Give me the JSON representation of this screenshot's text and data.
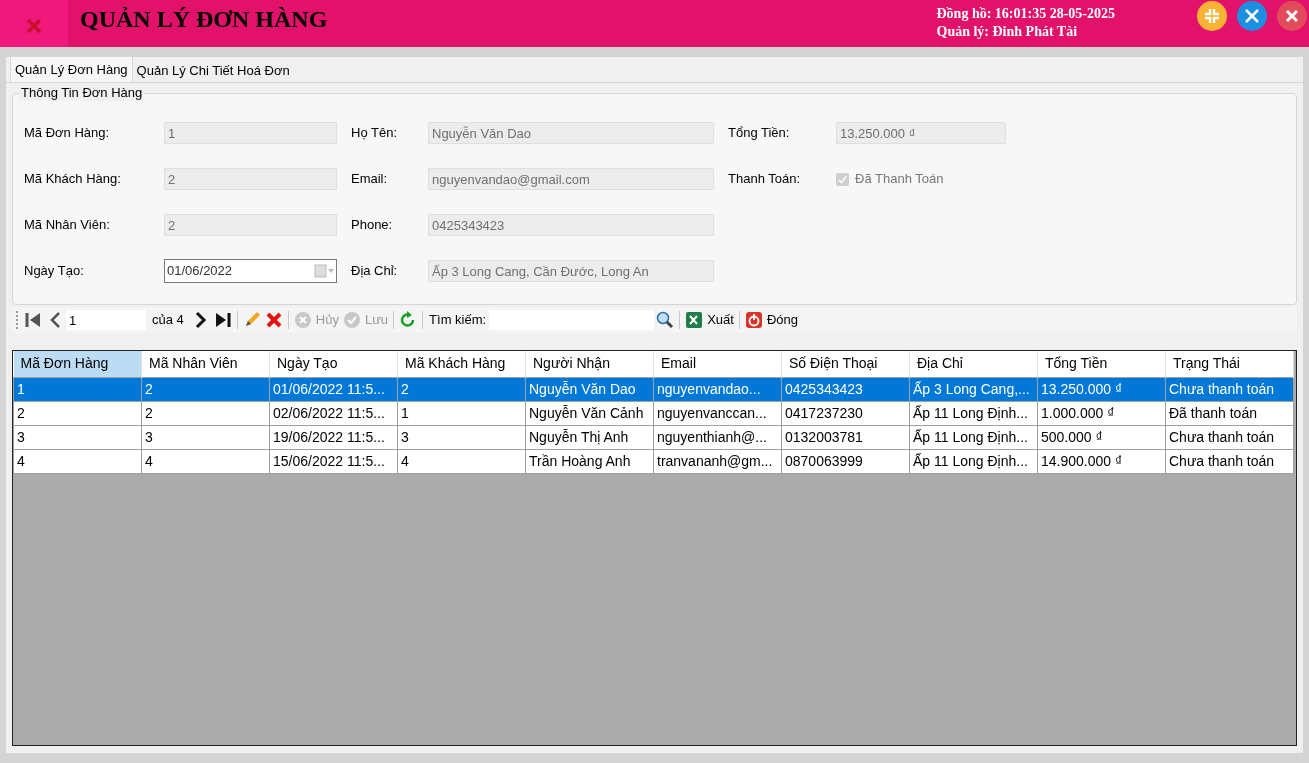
{
  "header": {
    "title": "QUẢN LÝ ĐƠN HÀNG",
    "clock": "Đồng hồ: 16:01:35 28-05-2025",
    "manager": "Quản lý: Đinh Phát Tài"
  },
  "tabs": [
    {
      "label": "Quản Lý Đơn Hàng",
      "selected": true
    },
    {
      "label": "Quản Lý Chi Tiết Hoá Đơn",
      "selected": false
    }
  ],
  "group": {
    "title": "Thông Tin Đơn Hàng",
    "field_columns": [
      [
        {
          "kind": "text",
          "label": "Mã Đơn Hàng:",
          "value": "1"
        },
        {
          "kind": "text",
          "label": "Mã Khách Hàng:",
          "value": "2"
        },
        {
          "kind": "text",
          "label": "Mã Nhân Viên:",
          "value": "2"
        },
        {
          "kind": "date",
          "label": "Ngày Tạo:",
          "value": "01/06/2022"
        }
      ],
      [
        {
          "kind": "text",
          "label": "Họ Tên:",
          "value": "Nguyễn Văn Dao"
        },
        {
          "kind": "text",
          "label": "Email:",
          "value": "nguyenvandao@gmail.com"
        },
        {
          "kind": "text",
          "label": "Phone:",
          "value": "0425343423"
        },
        {
          "kind": "text",
          "label": "Địa Chỉ:",
          "value": "Ấp 3 Long Cang, Cần Đước, Long An"
        }
      ],
      [
        {
          "kind": "text",
          "label": "Tổng Tiền:",
          "value": "13.250.000 ₫"
        },
        {
          "kind": "checkbox",
          "label": "Thanh Toán:",
          "value": "Đã Thanh Toán",
          "checked": true,
          "disabled": true
        }
      ]
    ]
  },
  "toolbar": [
    {
      "kind": "first"
    },
    {
      "kind": "prev"
    },
    {
      "kind": "position",
      "value": "1"
    },
    {
      "kind": "count",
      "label": "của 4"
    },
    {
      "kind": "next"
    },
    {
      "kind": "last"
    },
    {
      "kind": "sep"
    },
    {
      "kind": "edit"
    },
    {
      "kind": "delete"
    },
    {
      "kind": "sep"
    },
    {
      "kind": "cancel",
      "label": "Hủy",
      "disabled": true
    },
    {
      "kind": "save",
      "label": "Lưu",
      "disabled": true
    },
    {
      "kind": "sep"
    },
    {
      "kind": "refresh"
    },
    {
      "kind": "sep"
    },
    {
      "kind": "search_label",
      "label": "Tìm kiếm:"
    },
    {
      "kind": "search_field"
    },
    {
      "kind": "search_button"
    },
    {
      "kind": "sep"
    },
    {
      "kind": "export",
      "label": "Xuất"
    },
    {
      "kind": "sep"
    },
    {
      "kind": "close",
      "label": "Đóng"
    }
  ],
  "table": {
    "columns": [
      {
        "label": "Mã Đơn Hàng",
        "selected": true
      },
      {
        "label": "Mã Nhân Viên",
        "selected": false
      },
      {
        "label": "Ngày Tạo",
        "selected": false
      },
      {
        "label": "Mã Khách Hàng",
        "selected": false
      },
      {
        "label": "Người Nhận",
        "selected": false
      },
      {
        "label": "Email",
        "selected": false
      },
      {
        "label": "Số Điện Thoại",
        "selected": false
      },
      {
        "label": "Địa Chỉ",
        "selected": false
      },
      {
        "label": "Tổng Tiền",
        "selected": false
      },
      {
        "label": "Trạng Thái",
        "selected": false
      }
    ],
    "rows": [
      {
        "selected": true,
        "cells": [
          "1",
          "2",
          "01/06/2022 11:5...",
          "2",
          "Nguyễn Văn Dao",
          "nguyenvandao...",
          "0425343423",
          "Ấp 3 Long Cang,...",
          "13.250.000 ₫",
          "Chưa thanh toán"
        ]
      },
      {
        "selected": false,
        "cells": [
          "2",
          "2",
          "02/06/2022 11:5...",
          "1",
          "Nguyễn Văn Cảnh",
          "nguyenvanccan...",
          "0417237230",
          "Ấp 11 Long Định...",
          "1.000.000 ₫",
          "Đã thanh toán"
        ]
      },
      {
        "selected": false,
        "cells": [
          "3",
          "3",
          "19/06/2022 11:5...",
          "3",
          "Nguyễn Thị Anh",
          "nguyenthianh@...",
          "0132003781",
          "Ấp 11 Long Định...",
          "500.000 ₫",
          "Chưa thanh toán"
        ]
      },
      {
        "selected": false,
        "cells": [
          "4",
          "4",
          "15/06/2022 11:5...",
          "4",
          "Trần Hoàng Anh",
          "tranvananh@gm...",
          "0870063999",
          "Ấp 11 Long Định...",
          "14.900.000 ₫",
          "Chưa thanh toán"
        ]
      }
    ]
  }
}
